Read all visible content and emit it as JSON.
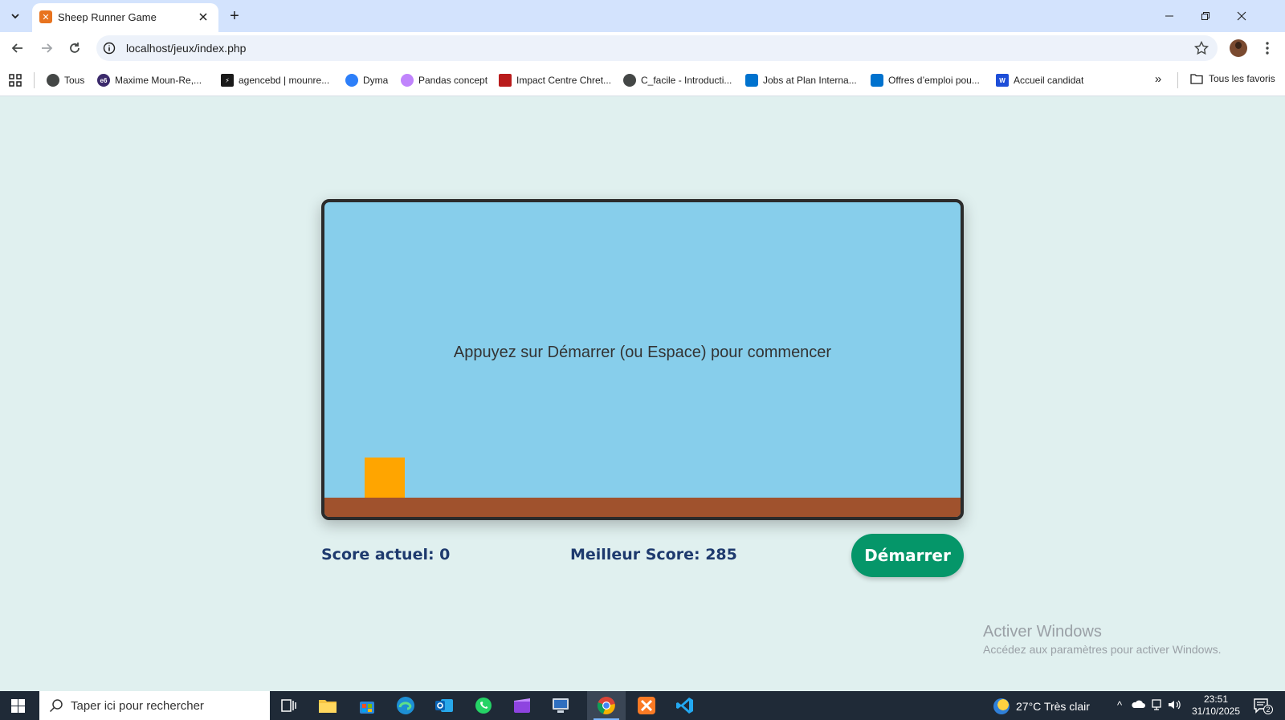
{
  "browser": {
    "tab_title": "Sheep Runner Game",
    "url": "localhost/jeux/index.php",
    "bookmarks": [
      {
        "label": "Tous",
        "color": "#444746"
      },
      {
        "label": "Maxime Moun-Re,...",
        "color": "#3b2a6b"
      },
      {
        "label": "agencebd | mounre...",
        "color": "#1a1a1a"
      },
      {
        "label": "Dyma",
        "color": "#2d7ff9"
      },
      {
        "label": "Pandas concept",
        "color": "#c084fc"
      },
      {
        "label": "Impact Centre Chret...",
        "color": "#b91c1c"
      },
      {
        "label": "C_facile - Introducti...",
        "color": "#444746"
      },
      {
        "label": "Jobs at Plan Interna...",
        "color": "#0072ce"
      },
      {
        "label": "Offres d’emploi pou...",
        "color": "#0072ce"
      },
      {
        "label": "Accueil candidat",
        "color": "#1d4ed8"
      }
    ],
    "all_bookmarks": "Tous les favoris"
  },
  "game": {
    "message": "Appuyez sur Démarrer (ou Espace) pour commencer",
    "sky_color": "#87ceeb",
    "ground_color": "#a0522d",
    "sheep_color": "#ffa500"
  },
  "scores": {
    "current": "Score actuel: 0",
    "best": "Meilleur Score: 285"
  },
  "controls": {
    "start_label": "Démarrer",
    "start_color": "#059669"
  },
  "watermark": {
    "title": "Activer Windows",
    "subtitle": "Accédez aux paramètres pour activer Windows."
  },
  "taskbar": {
    "search_placeholder": "Taper ici pour rechercher",
    "weather": "27°C  Très clair",
    "time": "23:51",
    "date": "31/10/2025",
    "notifications": "2"
  }
}
